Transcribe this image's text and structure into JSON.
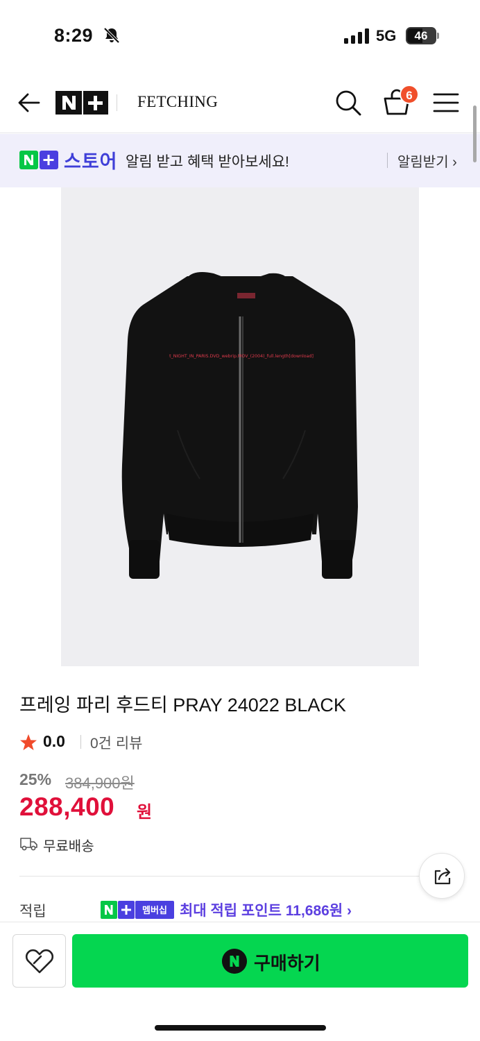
{
  "status_bar": {
    "time": "8:29",
    "network": "5G",
    "battery": "46"
  },
  "header": {
    "brand": "FETCHING",
    "cart_count": "6"
  },
  "banner": {
    "store_logo": "N+",
    "store_name": "스토어",
    "message": "알림 받고 혜택 받아보세요!",
    "link": "알림받기 ›"
  },
  "product": {
    "image_alt": "black zip-up hoodie",
    "print_text": "t_NIGHT_IN_PARIS.DVD_webrip.MOV_(2004)_full.length[download]",
    "title": "프레잉 파리 후드티 PRAY 24022 BLACK",
    "rating": "0.0",
    "reviews": "0건 리뷰",
    "discount": "25%",
    "original_price": "384,900원",
    "price": "288,400",
    "currency": "원",
    "shipping": "무료배송",
    "points_label": "적립",
    "membership_badge": "멤버십",
    "points_text": "최대 적립 포인트 11,686원 ›"
  },
  "bottom_bar": {
    "buy_label": "구매하기"
  },
  "icons": {
    "status": [
      "bell-slash-icon",
      "signal-icon",
      "battery-icon"
    ],
    "header": [
      "back-arrow-icon",
      "search-icon",
      "cart-icon",
      "menu-icon"
    ],
    "product": [
      "star-icon",
      "truck-icon",
      "share-icon",
      "heart-icon",
      "naver-n-icon"
    ]
  },
  "colors": {
    "accent_green": "#05d650",
    "price_red": "#e0103a",
    "store_blue": "#3f3fd8",
    "points_purple": "#5c3fe0",
    "badge_orange": "#f04f2b"
  }
}
